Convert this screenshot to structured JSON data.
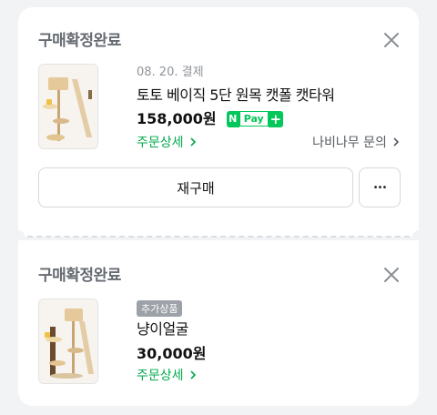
{
  "orders": [
    {
      "status": "구매확정완료",
      "date": "08. 20. 결제",
      "product_name": "토토 베이직 5단 원목 캣폴 캣타워",
      "price": "158,000원",
      "npay": {
        "letter": "N",
        "text": "Pay",
        "plus": "+"
      },
      "order_detail_label": "주문상세",
      "seller_inquiry_label": "나비나무 문의",
      "rebuy_label": "재구매",
      "more_label": "•••"
    },
    {
      "status": "구매확정완료",
      "badge": "추가상품",
      "product_name": "냥이얼굴",
      "price": "30,000원",
      "order_detail_label": "주문상세"
    }
  ],
  "colors": {
    "accent_green": "#03c75a",
    "link_green": "#03a94e",
    "status_gray": "#666b72"
  },
  "icons": [
    "close-icon",
    "chevron-right-icon",
    "more-icon",
    "npay-logo"
  ]
}
